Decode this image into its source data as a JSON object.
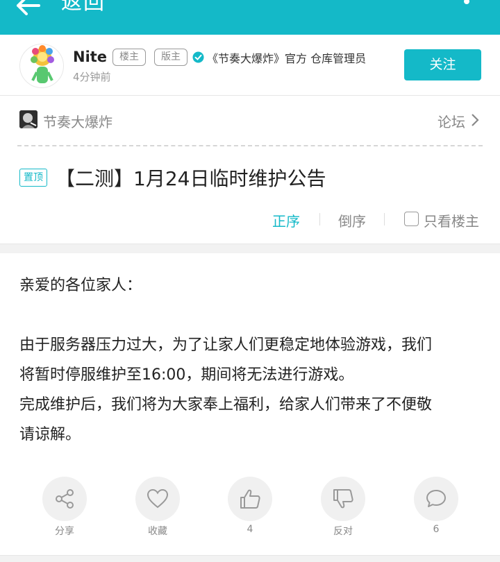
{
  "topbar": {
    "back_label": "返回"
  },
  "author": {
    "name": "Nite",
    "tag_op": "楼主",
    "tag_mod": "版主",
    "verify_text": "《节奏大爆炸》官方 仓库管理员",
    "time": "4分钟前",
    "follow_label": "关注"
  },
  "forum": {
    "name": "节奏大爆炸",
    "link_label": "论坛"
  },
  "post": {
    "pin_badge": "置顶",
    "title": "【二测】1月24日临时维护公告",
    "sort_asc": "正序",
    "sort_desc": "倒序",
    "only_op": "只看楼主",
    "lines": [
      "亲爱的各位家人：",
      "由于服务器压力过大，为了让家人们更稳定地体验游戏，我们",
      "将暂时停服维护至16:00，期间将无法进行游戏。",
      "完成维护后，我们将为大家奉上福利，给家人们带来了不便敬",
      "请谅解。"
    ]
  },
  "actions": {
    "share": "分享",
    "favorite": "收藏",
    "like_count": "4",
    "dislike": "反对",
    "comment_count": "6"
  },
  "colors": {
    "accent": "#14b9c8"
  }
}
